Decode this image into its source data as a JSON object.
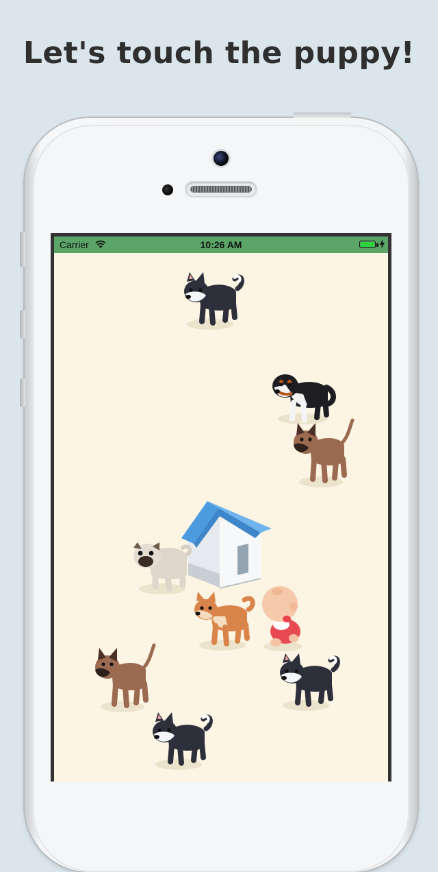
{
  "headline": "Let's touch the puppy!",
  "statusbar": {
    "carrier": "Carrier",
    "time": "10:26 AM",
    "battery_level": 1.0
  },
  "colors": {
    "background": "#dbe6ec",
    "statusbar": "#5aa567",
    "ground": "#fdf5e4"
  },
  "scene": {
    "dogs": [
      {
        "breed": "husky",
        "icon": "husky-dog-icon"
      },
      {
        "breed": "bernese",
        "icon": "bernese-dog-icon"
      },
      {
        "breed": "boxer",
        "icon": "boxer-dog-icon"
      },
      {
        "breed": "pug",
        "icon": "pug-dog-icon"
      },
      {
        "breed": "shiba",
        "icon": "shiba-dog-icon"
      },
      {
        "breed": "boxer",
        "icon": "boxer-dog-icon"
      },
      {
        "breed": "husky",
        "icon": "husky-dog-icon"
      },
      {
        "breed": "husky",
        "icon": "husky-dog-icon"
      }
    ],
    "doghouse": {
      "icon": "doghouse-icon"
    },
    "baby": {
      "icon": "baby-icon"
    }
  }
}
